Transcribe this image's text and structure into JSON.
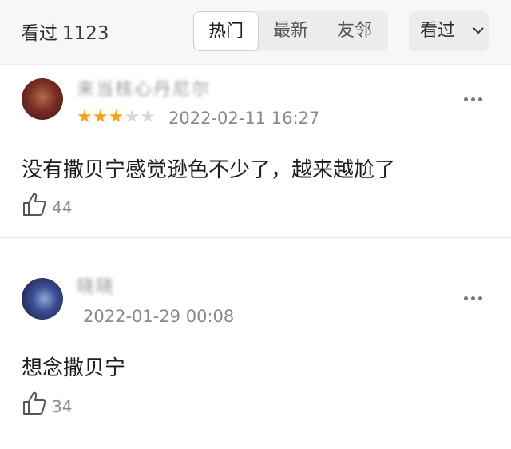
{
  "header": {
    "view_label": "看过",
    "view_count": "1123",
    "tabs": [
      {
        "label": "热门",
        "active": true
      },
      {
        "label": "最新",
        "active": false
      },
      {
        "label": "友邻",
        "active": false
      }
    ],
    "filter_label": "看过",
    "filter_icon": "chevron-down-icon"
  },
  "comments": [
    {
      "username": "来当核心丹尼尔",
      "rating": 3,
      "rating_max": 5,
      "datetime": "2022-02-11 16:27",
      "text": "没有撒贝宁感觉逊色不少了，越来越尬了",
      "likes": "44",
      "more_icon": "more-icon"
    },
    {
      "username": "晓晓",
      "datetime": "2022-01-29 00:08",
      "text": "想念撒贝宁",
      "likes": "34",
      "more_icon": "more-icon"
    }
  ],
  "colors": {
    "star_on": "#f2a51c",
    "star_off": "#d6d6d6",
    "header_bg": "#f7f7f7"
  }
}
